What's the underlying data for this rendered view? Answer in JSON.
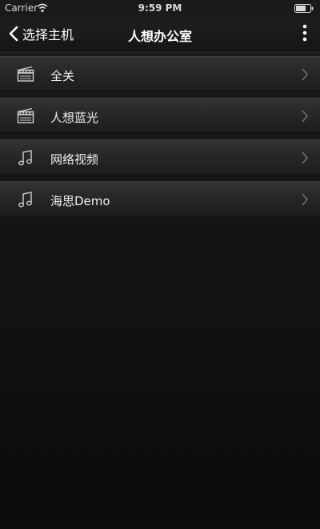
{
  "status_bar": {
    "carrier": "Carrier",
    "time": "9:59 PM"
  },
  "nav": {
    "back_label": "选择主机",
    "title": "人想办公室"
  },
  "rows": [
    {
      "label": "全关",
      "icon": "clapperboard-icon"
    },
    {
      "label": "人想蓝光",
      "icon": "clapperboard-icon"
    },
    {
      "label": "网络视频",
      "icon": "music-note-icon"
    },
    {
      "label": "海思Demo",
      "icon": "music-note-icon"
    }
  ]
}
